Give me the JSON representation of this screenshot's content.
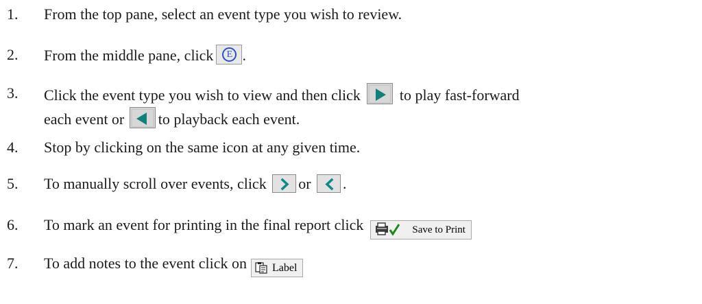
{
  "steps": [
    {
      "num": "1.",
      "text": "From the top pane, select an event type you wish to review."
    },
    {
      "num": "2.",
      "text_before": "From the middle pane, click",
      "text_after": "."
    },
    {
      "num": "3.",
      "text_before": "Click the event type you wish to view and then click",
      "text_mid": "to play fast-forward",
      "line2_before": "each event or",
      "line2_after": "to playback each event."
    },
    {
      "num": "4.",
      "text": "Stop by clicking on the same icon at any given time."
    },
    {
      "num": "5.",
      "text_before": "To manually scroll over events, click",
      "text_mid": "or",
      "text_after": "."
    },
    {
      "num": "6.",
      "text_before": "To mark an event for printing  in the final report click",
      "button_label": "Save to Print"
    },
    {
      "num": "7.",
      "text_before": "To add notes to the event click on",
      "button_label": "Label"
    }
  ],
  "icons": {
    "e_button": "E",
    "colors": {
      "e_blue": "#2a4fd6",
      "play_teal": "#10807a",
      "arrow_teal": "#0e8a86",
      "print_check_green": "#1a8a1a"
    }
  }
}
